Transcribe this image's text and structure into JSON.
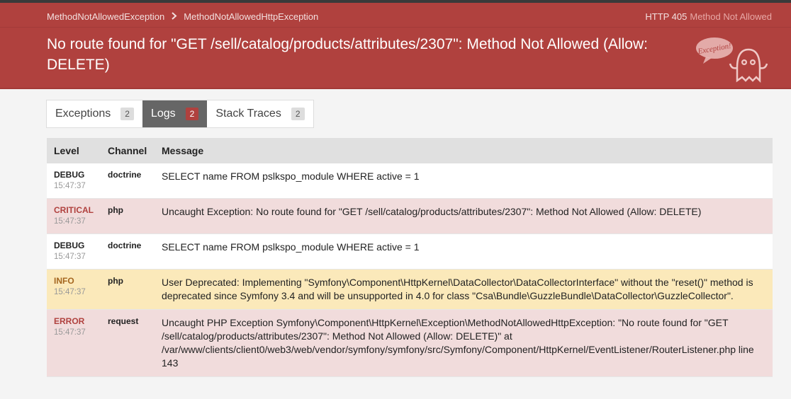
{
  "breadcrumb": {
    "items": [
      "MethodNotAllowedException",
      "MethodNotAllowedHttpException"
    ]
  },
  "status": {
    "code": "HTTP 405",
    "text": "Method Not Allowed"
  },
  "title": "No route found for \"GET /sell/catalog/products/attributes/2307\": Method Not Allowed (Allow: DELETE)",
  "logo_text": "Exception!",
  "tabs": [
    {
      "label": "Exceptions",
      "count": "2"
    },
    {
      "label": "Logs",
      "count": "2"
    },
    {
      "label": "Stack Traces",
      "count": "2"
    }
  ],
  "table": {
    "headers": [
      "Level",
      "Channel",
      "Message"
    ],
    "rows": [
      {
        "level": "DEBUG",
        "time": "15:47:37",
        "channel": "doctrine",
        "message": "SELECT name FROM pslkspo_module WHERE active = 1"
      },
      {
        "level": "CRITICAL",
        "time": "15:47:37",
        "channel": "php",
        "message": "Uncaught Exception: No route found for \"GET /sell/catalog/products/attributes/2307\": Method Not Allowed (Allow: DELETE)"
      },
      {
        "level": "DEBUG",
        "time": "15:47:37",
        "channel": "doctrine",
        "message": "SELECT name FROM pslkspo_module WHERE active = 1"
      },
      {
        "level": "INFO",
        "time": "15:47:37",
        "channel": "php",
        "message": "User Deprecated: Implementing \"Symfony\\Component\\HttpKernel\\DataCollector\\DataCollectorInterface\" without the \"reset()\" method is deprecated since Symfony 3.4 and will be unsupported in 4.0 for class \"Csa\\Bundle\\GuzzleBundle\\DataCollector\\GuzzleCollector\"."
      },
      {
        "level": "ERROR",
        "time": "15:47:37",
        "channel": "request",
        "message": "Uncaught PHP Exception Symfony\\Component\\HttpKernel\\Exception\\MethodNotAllowedHttpException: \"No route found for \"GET /sell/catalog/products/attributes/2307\": Method Not Allowed (Allow: DELETE)\" at /var/www/clients/client0/web3/web/vendor/symfony/symfony/src/Symfony/Component/HttpKernel/EventListener/RouterListener.php line 143"
      }
    ]
  },
  "colors": {
    "header": "#b0413e",
    "tab_active": "#666666",
    "critical_row": "#f1dcdc",
    "info_row": "#fbe9ba"
  }
}
